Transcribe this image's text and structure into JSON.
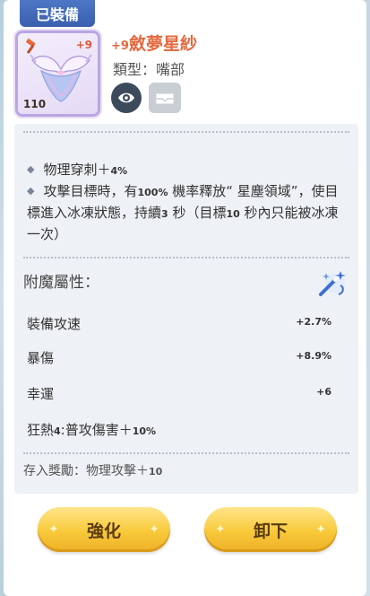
{
  "header": {
    "equipped_tag": "已裝備",
    "item_level": "+9",
    "item_name_plus": "+9",
    "item_name": "斂夢星紗",
    "item_type": "類型：嘴部",
    "power": "110"
  },
  "icons": {
    "eye": "eye-icon",
    "lock": "tray-icon",
    "hammer": "hammer-icon",
    "wand": "magic-wand-icon"
  },
  "effects": [
    {
      "text_a": "物理穿刺＋",
      "num": "4%"
    },
    {
      "text_a": "攻擊目標時，有",
      "num": "100%",
      "text_b": " 機率釋放“ 星塵領域”，使目標進入冰凍狀態，持續",
      "num2": "3",
      "text_c": " 秒（目標",
      "num3": "10",
      "text_d": " 秒內只能被冰凍一次）"
    }
  ],
  "enchant": {
    "title": "附魔屬性：",
    "stats": [
      {
        "label": "裝備攻速",
        "value": "+2.7%"
      },
      {
        "label": "暴傷",
        "value": "+8.9%"
      },
      {
        "label": "幸運",
        "value": "+6"
      }
    ],
    "special_label": "狂熱",
    "special_num": "4",
    "special_text": ":普攻傷害＋",
    "special_value": "10%"
  },
  "deposit": {
    "label": "存入獎勵：物理攻擊＋",
    "value": "10"
  },
  "buttons": {
    "enhance": "強化",
    "unequip": "卸下"
  },
  "colors": {
    "accent_name": "#e5683e",
    "tag_blue": "#3a5fae",
    "button_gold": "#f8c93a"
  }
}
